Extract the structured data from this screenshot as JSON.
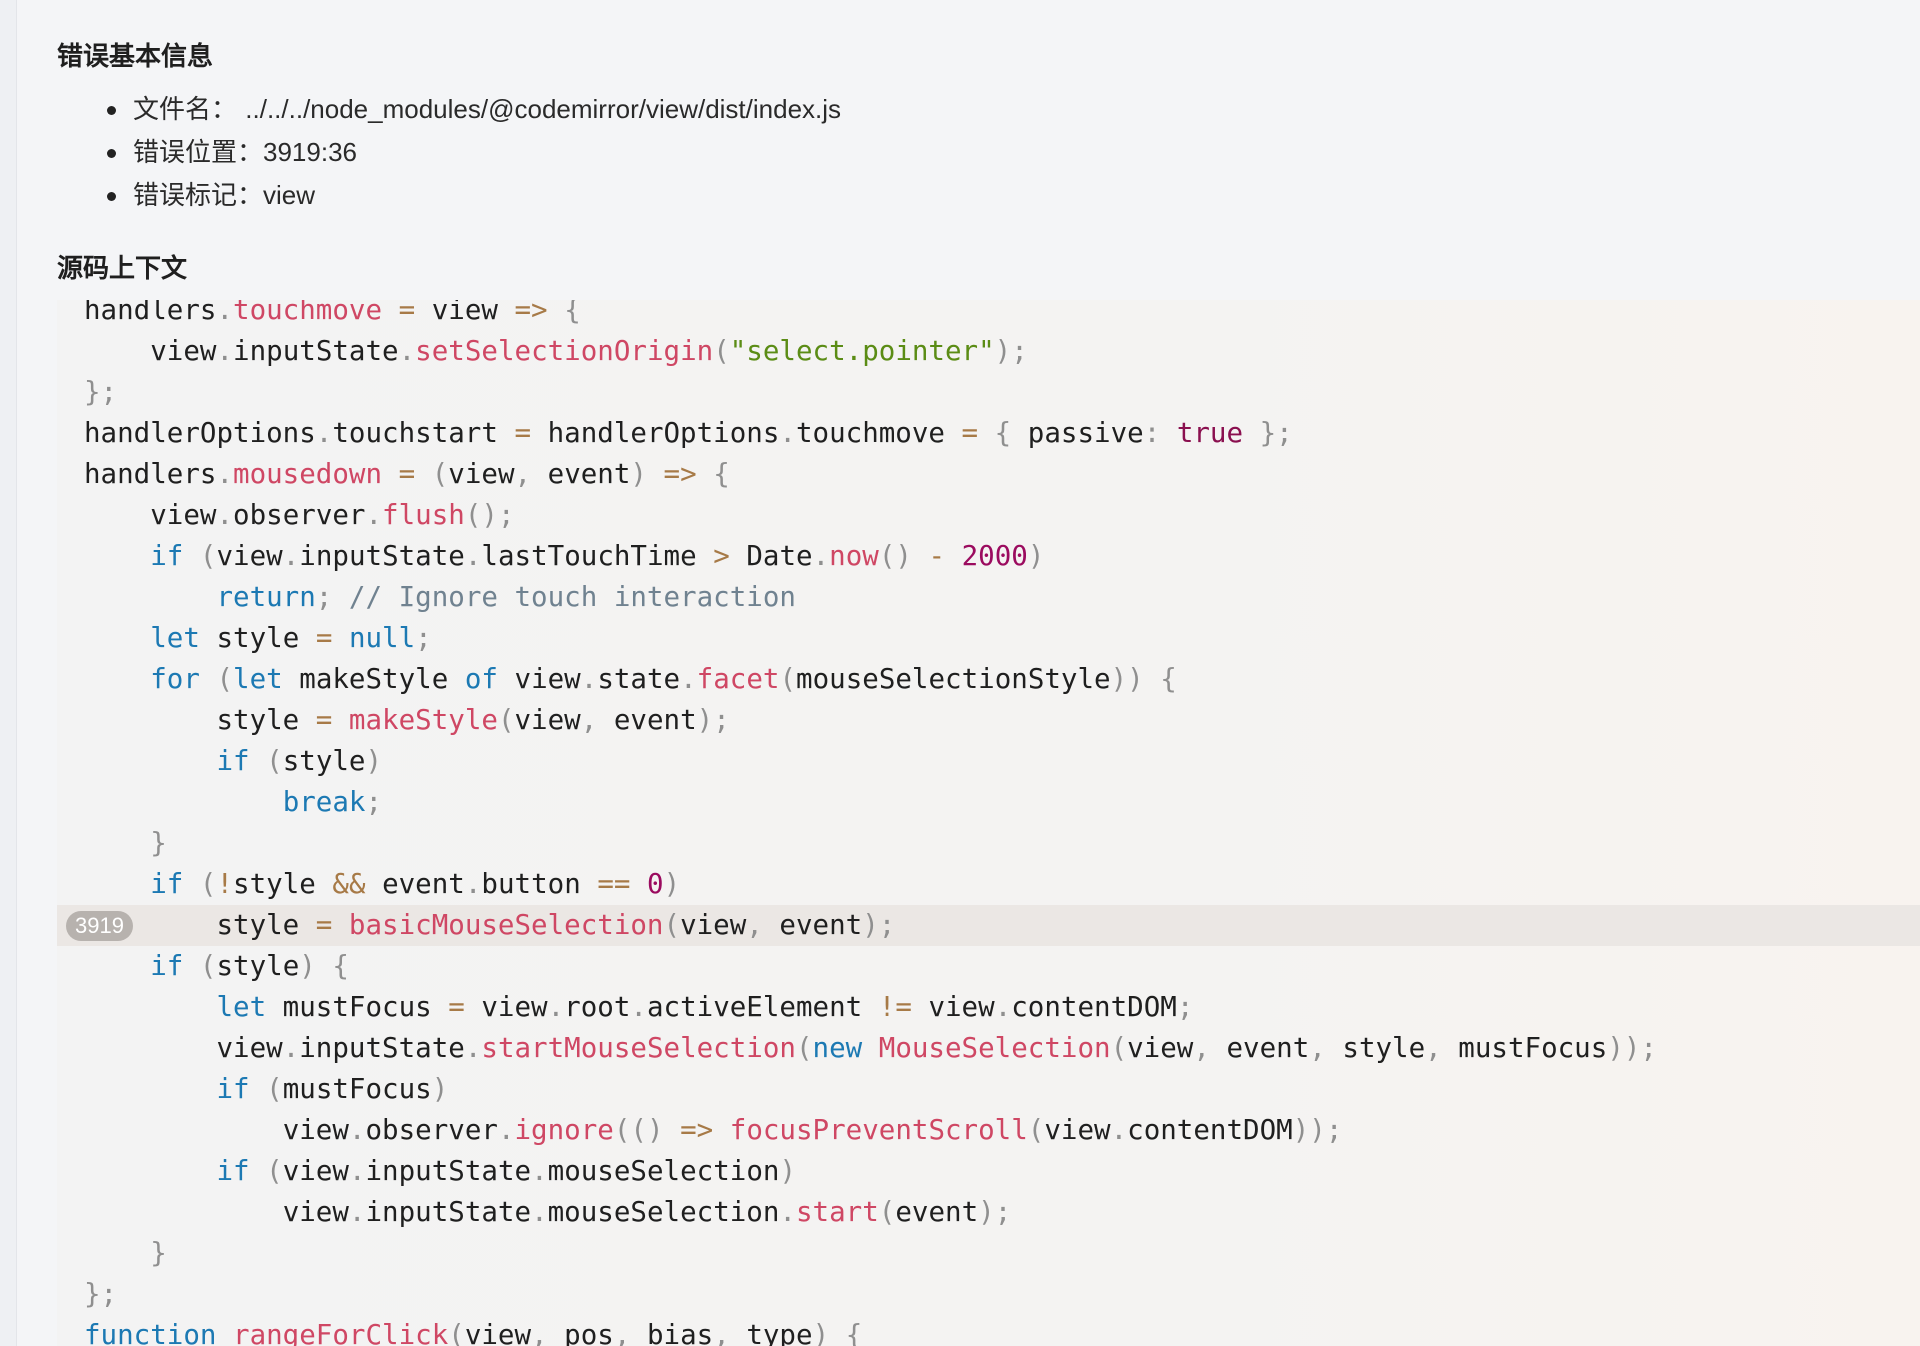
{
  "sections": {
    "basic_info_title": "错误基本信息",
    "source_context_title": "源码上下文"
  },
  "info_items": [
    {
      "label": "文件名：",
      "value": "../../../node_modules/@codemirror/view/dist/index.js"
    },
    {
      "label": "错误位置：",
      "value": "3919:36"
    },
    {
      "label": "错误标记：",
      "value": "view"
    }
  ],
  "code": {
    "highlight_line_number": "3919",
    "colors": {
      "keyword": "#1c79b3",
      "function": "#cf4764",
      "string": "#5b8c15",
      "number": "#9b0b5f",
      "comment": "#708290",
      "highlight_bg": "#ebe7e4"
    },
    "lines": [
      {
        "indent": 0,
        "tokens": [
          [
            "id",
            "handlers"
          ],
          [
            "pun",
            "."
          ],
          [
            "fn",
            "touchmove"
          ],
          [
            "id",
            " "
          ],
          [
            "op",
            "="
          ],
          [
            "id",
            " view "
          ],
          [
            "op",
            "=>"
          ],
          [
            "id",
            " "
          ],
          [
            "pun",
            "{"
          ]
        ]
      },
      {
        "indent": 1,
        "tokens": [
          [
            "id",
            "view"
          ],
          [
            "pun",
            "."
          ],
          [
            "id",
            "inputState"
          ],
          [
            "pun",
            "."
          ],
          [
            "fn",
            "setSelectionOrigin"
          ],
          [
            "pun",
            "("
          ],
          [
            "str",
            "\"select.pointer\""
          ],
          [
            "pun",
            ");"
          ]
        ]
      },
      {
        "indent": 0,
        "tokens": [
          [
            "pun",
            "};"
          ]
        ]
      },
      {
        "indent": 0,
        "tokens": [
          [
            "id",
            "handlerOptions"
          ],
          [
            "pun",
            "."
          ],
          [
            "id",
            "touchstart "
          ],
          [
            "op",
            "="
          ],
          [
            "id",
            " handlerOptions"
          ],
          [
            "pun",
            "."
          ],
          [
            "id",
            "touchmove "
          ],
          [
            "op",
            "="
          ],
          [
            "id",
            " "
          ],
          [
            "pun",
            "{"
          ],
          [
            "id",
            " passive"
          ],
          [
            "pun",
            ":"
          ],
          [
            "id",
            " "
          ],
          [
            "bool",
            "true"
          ],
          [
            "id",
            " "
          ],
          [
            "pun",
            "};"
          ]
        ]
      },
      {
        "indent": 0,
        "tokens": [
          [
            "id",
            "handlers"
          ],
          [
            "pun",
            "."
          ],
          [
            "fn",
            "mousedown"
          ],
          [
            "id",
            " "
          ],
          [
            "op",
            "="
          ],
          [
            "id",
            " "
          ],
          [
            "pun",
            "("
          ],
          [
            "id",
            "view"
          ],
          [
            "pun",
            ","
          ],
          [
            "id",
            " event"
          ],
          [
            "pun",
            ")"
          ],
          [
            "id",
            " "
          ],
          [
            "op",
            "=>"
          ],
          [
            "id",
            " "
          ],
          [
            "pun",
            "{"
          ]
        ]
      },
      {
        "indent": 1,
        "tokens": [
          [
            "id",
            "view"
          ],
          [
            "pun",
            "."
          ],
          [
            "id",
            "observer"
          ],
          [
            "pun",
            "."
          ],
          [
            "fn",
            "flush"
          ],
          [
            "pun",
            "();"
          ]
        ]
      },
      {
        "indent": 1,
        "tokens": [
          [
            "kw",
            "if"
          ],
          [
            "id",
            " "
          ],
          [
            "pun",
            "("
          ],
          [
            "id",
            "view"
          ],
          [
            "pun",
            "."
          ],
          [
            "id",
            "inputState"
          ],
          [
            "pun",
            "."
          ],
          [
            "id",
            "lastTouchTime "
          ],
          [
            "op",
            ">"
          ],
          [
            "id",
            " Date"
          ],
          [
            "pun",
            "."
          ],
          [
            "fn",
            "now"
          ],
          [
            "pun",
            "()"
          ],
          [
            "id",
            " "
          ],
          [
            "op",
            "-"
          ],
          [
            "id",
            " "
          ],
          [
            "num",
            "2000"
          ],
          [
            "pun",
            ")"
          ]
        ]
      },
      {
        "indent": 2,
        "tokens": [
          [
            "kw",
            "return"
          ],
          [
            "pun",
            ";"
          ],
          [
            "id",
            " "
          ],
          [
            "cmt",
            "// Ignore touch interaction"
          ]
        ]
      },
      {
        "indent": 1,
        "tokens": [
          [
            "kw",
            "let"
          ],
          [
            "id",
            " style "
          ],
          [
            "op",
            "="
          ],
          [
            "id",
            " "
          ],
          [
            "kw",
            "null"
          ],
          [
            "pun",
            ";"
          ]
        ]
      },
      {
        "indent": 1,
        "tokens": [
          [
            "kw",
            "for"
          ],
          [
            "id",
            " "
          ],
          [
            "pun",
            "("
          ],
          [
            "kw",
            "let"
          ],
          [
            "id",
            " makeStyle "
          ],
          [
            "kw",
            "of"
          ],
          [
            "id",
            " view"
          ],
          [
            "pun",
            "."
          ],
          [
            "id",
            "state"
          ],
          [
            "pun",
            "."
          ],
          [
            "fn",
            "facet"
          ],
          [
            "pun",
            "("
          ],
          [
            "id",
            "mouseSelectionStyle"
          ],
          [
            "pun",
            "))"
          ],
          [
            "id",
            " "
          ],
          [
            "pun",
            "{"
          ]
        ]
      },
      {
        "indent": 2,
        "tokens": [
          [
            "id",
            "style "
          ],
          [
            "op",
            "="
          ],
          [
            "id",
            " "
          ],
          [
            "fn",
            "makeStyle"
          ],
          [
            "pun",
            "("
          ],
          [
            "id",
            "view"
          ],
          [
            "pun",
            ","
          ],
          [
            "id",
            " event"
          ],
          [
            "pun",
            ");"
          ]
        ]
      },
      {
        "indent": 2,
        "tokens": [
          [
            "kw",
            "if"
          ],
          [
            "id",
            " "
          ],
          [
            "pun",
            "("
          ],
          [
            "id",
            "style"
          ],
          [
            "pun",
            ")"
          ]
        ]
      },
      {
        "indent": 3,
        "tokens": [
          [
            "kw",
            "break"
          ],
          [
            "pun",
            ";"
          ]
        ]
      },
      {
        "indent": 1,
        "tokens": [
          [
            "pun",
            "}"
          ]
        ]
      },
      {
        "indent": 1,
        "tokens": [
          [
            "kw",
            "if"
          ],
          [
            "id",
            " "
          ],
          [
            "pun",
            "("
          ],
          [
            "op",
            "!"
          ],
          [
            "id",
            "style "
          ],
          [
            "op",
            "&&"
          ],
          [
            "id",
            " event"
          ],
          [
            "pun",
            "."
          ],
          [
            "id",
            "button "
          ],
          [
            "op",
            "=="
          ],
          [
            "id",
            " "
          ],
          [
            "num",
            "0"
          ],
          [
            "pun",
            ")"
          ]
        ]
      },
      {
        "indent": 2,
        "highlight": true,
        "tokens": [
          [
            "id",
            "style "
          ],
          [
            "op",
            "="
          ],
          [
            "id",
            " "
          ],
          [
            "fn",
            "basicMouseSelection"
          ],
          [
            "pun",
            "("
          ],
          [
            "id",
            "view"
          ],
          [
            "pun",
            ","
          ],
          [
            "id",
            " event"
          ],
          [
            "pun",
            ");"
          ]
        ]
      },
      {
        "indent": 1,
        "tokens": [
          [
            "kw",
            "if"
          ],
          [
            "id",
            " "
          ],
          [
            "pun",
            "("
          ],
          [
            "id",
            "style"
          ],
          [
            "pun",
            ")"
          ],
          [
            "id",
            " "
          ],
          [
            "pun",
            "{"
          ]
        ]
      },
      {
        "indent": 2,
        "tokens": [
          [
            "kw",
            "let"
          ],
          [
            "id",
            " mustFocus "
          ],
          [
            "op",
            "="
          ],
          [
            "id",
            " view"
          ],
          [
            "pun",
            "."
          ],
          [
            "id",
            "root"
          ],
          [
            "pun",
            "."
          ],
          [
            "id",
            "activeElement "
          ],
          [
            "op",
            "!="
          ],
          [
            "id",
            " view"
          ],
          [
            "pun",
            "."
          ],
          [
            "id",
            "contentDOM"
          ],
          [
            "pun",
            ";"
          ]
        ]
      },
      {
        "indent": 2,
        "tokens": [
          [
            "id",
            "view"
          ],
          [
            "pun",
            "."
          ],
          [
            "id",
            "inputState"
          ],
          [
            "pun",
            "."
          ],
          [
            "fn",
            "startMouseSelection"
          ],
          [
            "pun",
            "("
          ],
          [
            "kw",
            "new"
          ],
          [
            "id",
            " "
          ],
          [
            "fn",
            "MouseSelection"
          ],
          [
            "pun",
            "("
          ],
          [
            "id",
            "view"
          ],
          [
            "pun",
            ","
          ],
          [
            "id",
            " event"
          ],
          [
            "pun",
            ","
          ],
          [
            "id",
            " style"
          ],
          [
            "pun",
            ","
          ],
          [
            "id",
            " mustFocus"
          ],
          [
            "pun",
            "));"
          ]
        ]
      },
      {
        "indent": 2,
        "tokens": [
          [
            "kw",
            "if"
          ],
          [
            "id",
            " "
          ],
          [
            "pun",
            "("
          ],
          [
            "id",
            "mustFocus"
          ],
          [
            "pun",
            ")"
          ]
        ]
      },
      {
        "indent": 3,
        "tokens": [
          [
            "id",
            "view"
          ],
          [
            "pun",
            "."
          ],
          [
            "id",
            "observer"
          ],
          [
            "pun",
            "."
          ],
          [
            "fn",
            "ignore"
          ],
          [
            "pun",
            "(()"
          ],
          [
            "id",
            " "
          ],
          [
            "op",
            "=>"
          ],
          [
            "id",
            " "
          ],
          [
            "fn",
            "focusPreventScroll"
          ],
          [
            "pun",
            "("
          ],
          [
            "id",
            "view"
          ],
          [
            "pun",
            "."
          ],
          [
            "id",
            "contentDOM"
          ],
          [
            "pun",
            "));"
          ]
        ]
      },
      {
        "indent": 2,
        "tokens": [
          [
            "kw",
            "if"
          ],
          [
            "id",
            " "
          ],
          [
            "pun",
            "("
          ],
          [
            "id",
            "view"
          ],
          [
            "pun",
            "."
          ],
          [
            "id",
            "inputState"
          ],
          [
            "pun",
            "."
          ],
          [
            "id",
            "mouseSelection"
          ],
          [
            "pun",
            ")"
          ]
        ]
      },
      {
        "indent": 3,
        "tokens": [
          [
            "id",
            "view"
          ],
          [
            "pun",
            "."
          ],
          [
            "id",
            "inputState"
          ],
          [
            "pun",
            "."
          ],
          [
            "id",
            "mouseSelection"
          ],
          [
            "pun",
            "."
          ],
          [
            "fn",
            "start"
          ],
          [
            "pun",
            "("
          ],
          [
            "id",
            "event"
          ],
          [
            "pun",
            ");"
          ]
        ]
      },
      {
        "indent": 1,
        "tokens": [
          [
            "pun",
            "}"
          ]
        ]
      },
      {
        "indent": 0,
        "tokens": [
          [
            "pun",
            "};"
          ]
        ]
      },
      {
        "indent": 0,
        "tokens": [
          [
            "kw",
            "function"
          ],
          [
            "id",
            " "
          ],
          [
            "fn",
            "rangeForClick"
          ],
          [
            "pun",
            "("
          ],
          [
            "id",
            "view"
          ],
          [
            "pun",
            ","
          ],
          [
            "id",
            " pos"
          ],
          [
            "pun",
            ","
          ],
          [
            "id",
            " bias"
          ],
          [
            "pun",
            ","
          ],
          [
            "id",
            " type"
          ],
          [
            "pun",
            ")"
          ],
          [
            "id",
            " "
          ],
          [
            "pun",
            "{"
          ]
        ]
      }
    ]
  }
}
